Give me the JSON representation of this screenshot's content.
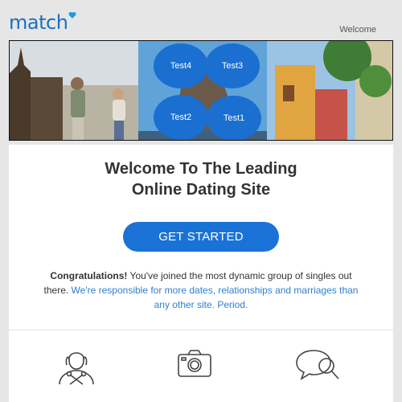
{
  "header": {
    "logo_text": "match",
    "welcome_label": "Welcome"
  },
  "banner": {
    "circles": [
      {
        "label": "Test4"
      },
      {
        "label": "Test3"
      },
      {
        "label": "Test2"
      },
      {
        "label": "Test1"
      }
    ]
  },
  "hero": {
    "headline_line1": "Welcome To The Leading",
    "headline_line2": "Online Dating Site",
    "cta_label": "GET STARTED"
  },
  "intro": {
    "strong": "Congratulations!",
    "text": " You've joined the most dynamic group of singles out there. ",
    "link_text": "We're responsible for more dates, relationships and marriages than any other site. Period."
  },
  "features": {
    "icons": [
      "profile-tools-icon",
      "camera-icon",
      "chat-search-icon"
    ]
  },
  "colors": {
    "brand": "#1b6fc0",
    "cta": "#1b72d6",
    "link": "#2f7fce"
  }
}
